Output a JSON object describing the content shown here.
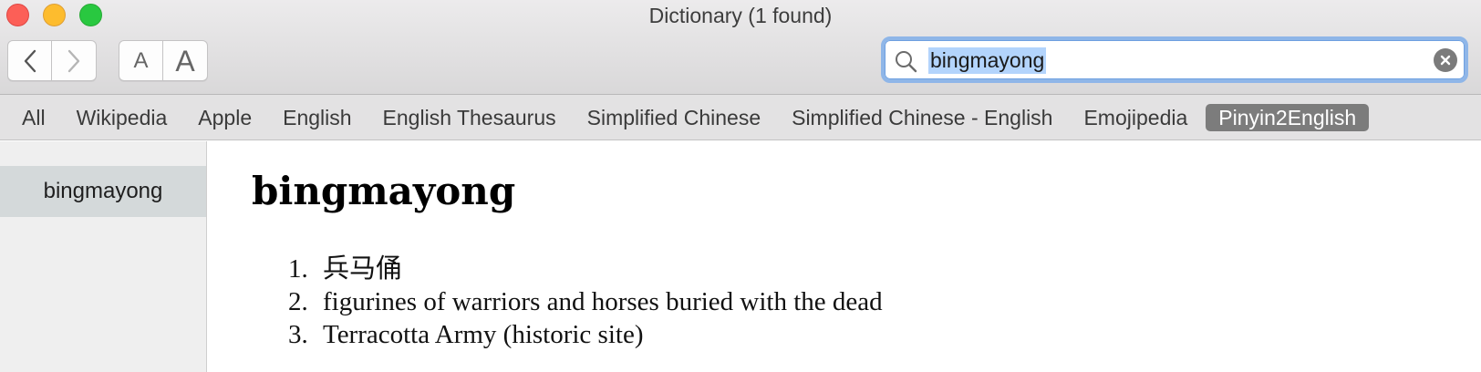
{
  "window": {
    "title": "Dictionary (1 found)"
  },
  "toolbar": {
    "back_icon": "chevron-left-icon",
    "forward_icon": "chevron-right-icon",
    "font_small_label": "A",
    "font_large_label": "A"
  },
  "search": {
    "query": "bingmayong",
    "icon": "magnifier-icon",
    "clear_icon": "clear-icon"
  },
  "tabs": [
    {
      "label": "All"
    },
    {
      "label": "Wikipedia"
    },
    {
      "label": "Apple"
    },
    {
      "label": "English"
    },
    {
      "label": "English Thesaurus"
    },
    {
      "label": "Simplified Chinese"
    },
    {
      "label": "Simplified Chinese - English"
    },
    {
      "label": "Emojipedia"
    },
    {
      "label": "Pinyin2English",
      "active": true
    }
  ],
  "sidebar": {
    "items": [
      {
        "label": "bingmayong",
        "selected": true
      }
    ]
  },
  "entry": {
    "headword": "bingmayong",
    "definitions": [
      {
        "num": "1.",
        "text": "兵马俑"
      },
      {
        "num": "2.",
        "text": "figurines of warriors and horses buried with the dead"
      },
      {
        "num": "3.",
        "text": "Terracotta Army (historic site)"
      }
    ]
  },
  "colors": {
    "selection": "#b3d4fc",
    "focus_ring": "#8fb6e8",
    "active_tab": "#7c7c7c",
    "sidebar_selected": "#d4d9da"
  }
}
